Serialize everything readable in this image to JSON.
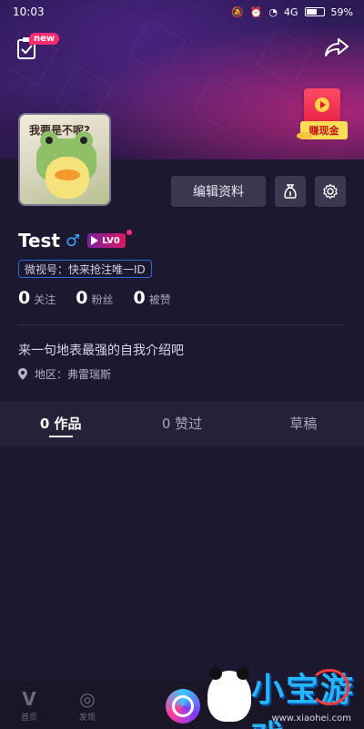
{
  "status_bar": {
    "time": "10:03",
    "battery": "59%",
    "signal": "4G"
  },
  "header": {
    "new_badge": "new",
    "cash_label": "赚现金"
  },
  "avatar": {
    "caption": "我要是不呢?"
  },
  "actions": {
    "edit_profile": "编辑资料"
  },
  "profile": {
    "name": "Test",
    "gender_symbol": "♂",
    "level": "LV0",
    "wechat_id": "微视号：快来抢注唯一ID",
    "bio": "来一句地表最强的自我介绍吧",
    "region": "地区：弗雷瑞斯"
  },
  "stats": [
    {
      "num": "0",
      "label": "关注"
    },
    {
      "num": "0",
      "label": "粉丝"
    },
    {
      "num": "0",
      "label": "被赞"
    }
  ],
  "tabs": [
    {
      "label": "0 作品",
      "active": true
    },
    {
      "label": "0 赞过",
      "active": false
    },
    {
      "label": "草稿",
      "active": false
    }
  ],
  "bottom_nav": [
    {
      "label": "首页",
      "icon": "home-v-icon"
    },
    {
      "label": "发现",
      "icon": "discover-icon"
    }
  ],
  "watermark": {
    "logo": "小宝游戏",
    "url": "www.xiaohei.com"
  },
  "colors": {
    "accent": "#ff2d6f",
    "background": "#1c1830",
    "button": "#3b3950",
    "gender": "#3aa6ff"
  }
}
